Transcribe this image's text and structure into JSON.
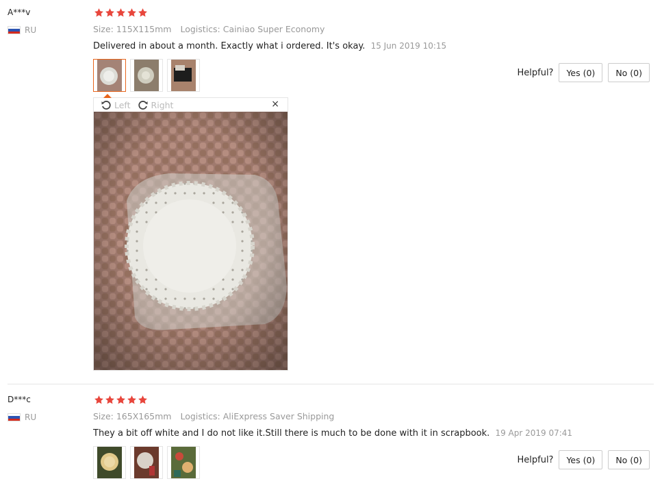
{
  "reviews": [
    {
      "buyer": "A***v",
      "country": "RU",
      "stars": 5,
      "size": "Size: 115X115mm",
      "logistics": "Logistics: Cainiao Super Economy",
      "text": "Delivered in about a month. Exactly what i ordered. It's okay.",
      "date": "15 Jun 2019 10:15",
      "helpful_label": "Helpful?",
      "yes_label": "Yes (0)",
      "no_label": "No (0)"
    },
    {
      "buyer": "D***c",
      "country": "RU",
      "stars": 5,
      "size": "Size: 165X165mm",
      "logistics": "Logistics: AliExpress Saver Shipping",
      "text": "They a bit off white and I do not like it.Still there is much to be done with it in scrapbook.",
      "date": "19 Apr 2019 07:41",
      "helpful_label": "Helpful?",
      "yes_label": "Yes (0)",
      "no_label": "No (0)"
    }
  ],
  "viewer": {
    "rotate_left": "Left",
    "rotate_right": "Right",
    "close": "×"
  },
  "colors": {
    "star": "#e8463c",
    "accent": "#e8641b"
  }
}
